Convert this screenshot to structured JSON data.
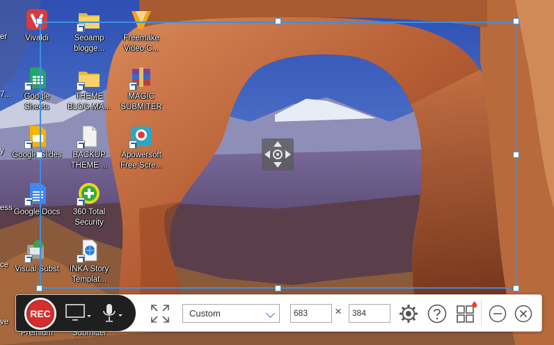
{
  "desktop": {
    "icons": [
      {
        "label": "Vivaldi",
        "name": "vivaldi"
      },
      {
        "label": "Seoamp\nblogge...",
        "name": "seoamp-folder"
      },
      {
        "label": "Freemake\nVideo C...",
        "name": "freemake"
      },
      {
        "label": "Google\nSheets",
        "name": "google-sheets"
      },
      {
        "label": "THEME\nBLOG MA...",
        "name": "theme-blog-folder"
      },
      {
        "label": "MAGIC\nSUBMITER",
        "name": "magic-submiter"
      },
      {
        "label": "Google Slides",
        "name": "google-slides"
      },
      {
        "label": "BACKUP\nTHEME ...",
        "name": "backup-theme"
      },
      {
        "label": "Apowersoft\nFree Scre...",
        "name": "apowersoft"
      },
      {
        "label": "Google Docs",
        "name": "google-docs"
      },
      {
        "label": "360 Total\nSecurity",
        "name": "360-total-security"
      },
      {
        "label": "Visual Subst",
        "name": "visual-subst"
      },
      {
        "label": "INKA Story\nTemplat...",
        "name": "inka-story"
      }
    ],
    "edge_labels": [
      "er",
      "7...",
      "y",
      "ess",
      "ce",
      "ve"
    ],
    "bottom_labels": [
      "Premium",
      "Submitter"
    ]
  },
  "toolbar": {
    "rec_label": "REC",
    "preset": "Custom",
    "width_value": "683",
    "height_value": "384",
    "times_sign": "×"
  },
  "colors": {
    "region_border": "#3d8fe0",
    "rec_red": "#d62d2d",
    "toolbar_bg": "#ffffff",
    "rec_zone_bg": "#1f1f1f"
  }
}
